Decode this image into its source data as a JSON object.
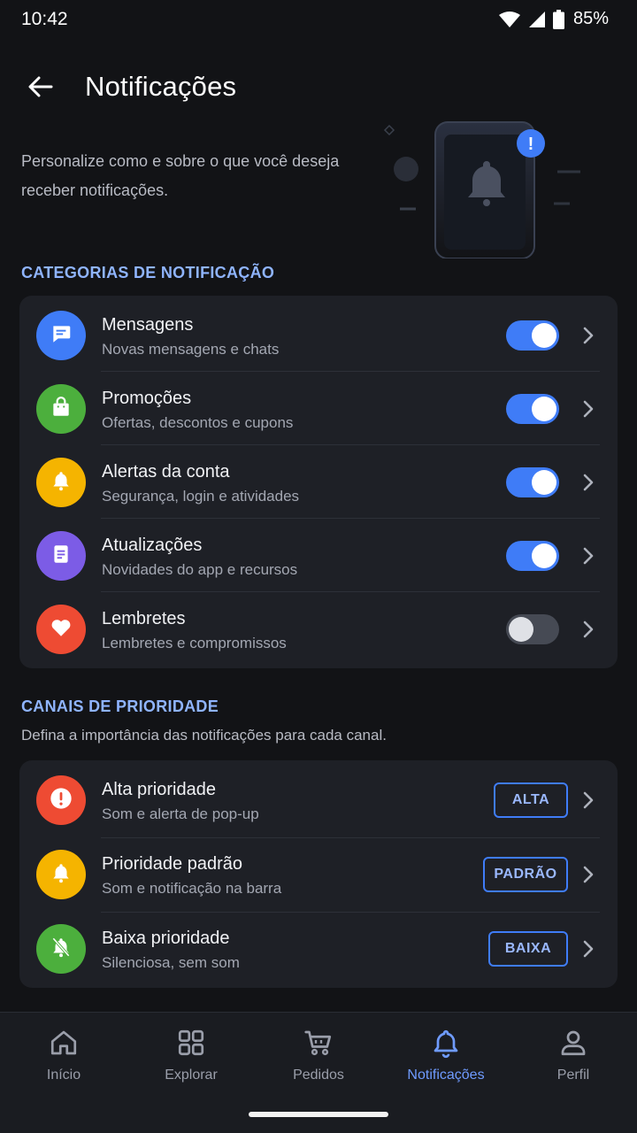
{
  "status": {
    "time": "10:42",
    "battery": "85%"
  },
  "header": {
    "title": "Notificações"
  },
  "intro": "Personalize como e sobre o que você deseja receber notificações.",
  "hero": {
    "badge": "!"
  },
  "categories": {
    "title": "CATEGORIAS DE NOTIFICAÇÃO",
    "items": [
      {
        "title": "Mensagens",
        "subtitle": "Novas mensagens e chats",
        "enabled": true,
        "icon": "chat-icon",
        "color": "#3f7cf7"
      },
      {
        "title": "Promoções",
        "subtitle": "Ofertas, descontos e cupons",
        "enabled": true,
        "icon": "shopping-bag-icon",
        "color": "#4caf3d"
      },
      {
        "title": "Alertas da conta",
        "subtitle": "Segurança, login e atividades",
        "enabled": true,
        "icon": "bell-icon",
        "color": "#f5b400"
      },
      {
        "title": "Atualizações",
        "subtitle": "Novidades do app e recursos",
        "enabled": true,
        "icon": "document-icon",
        "color": "#7c5ce6"
      },
      {
        "title": "Lembretes",
        "subtitle": "Lembretes e compromissos",
        "enabled": false,
        "icon": "heart-icon",
        "color": "#ee4b33"
      }
    ]
  },
  "channels": {
    "title": "CANAIS DE PRIORIDADE",
    "subtitle": "Defina a importância das notificações para cada canal.",
    "items": [
      {
        "title": "Alta prioridade",
        "subtitle": "Som e alerta de pop-up",
        "badge": "ALTA",
        "icon": "alert-circle-icon",
        "color": "#ee4b33"
      },
      {
        "title": "Prioridade padrão",
        "subtitle": "Som e notificação na barra",
        "badge": "PADRÃO",
        "icon": "bell-icon",
        "color": "#f5b400"
      },
      {
        "title": "Baixa prioridade",
        "subtitle": "Silenciosa, sem som",
        "badge": "BAIXA",
        "icon": "bell-off-icon",
        "color": "#4caf3d"
      }
    ]
  },
  "nav": {
    "items": [
      {
        "label": "Início",
        "icon": "home-icon",
        "active": false
      },
      {
        "label": "Explorar",
        "icon": "grid-icon",
        "active": false
      },
      {
        "label": "Pedidos",
        "icon": "cart-icon",
        "active": false
      },
      {
        "label": "Notificações",
        "icon": "bell-icon",
        "active": true
      },
      {
        "label": "Perfil",
        "icon": "person-icon",
        "active": false
      }
    ]
  },
  "colors": {
    "accent": "#3f7cf7",
    "background": "#121316",
    "card": "#1e2026",
    "section_title": "#8fb4ff"
  }
}
